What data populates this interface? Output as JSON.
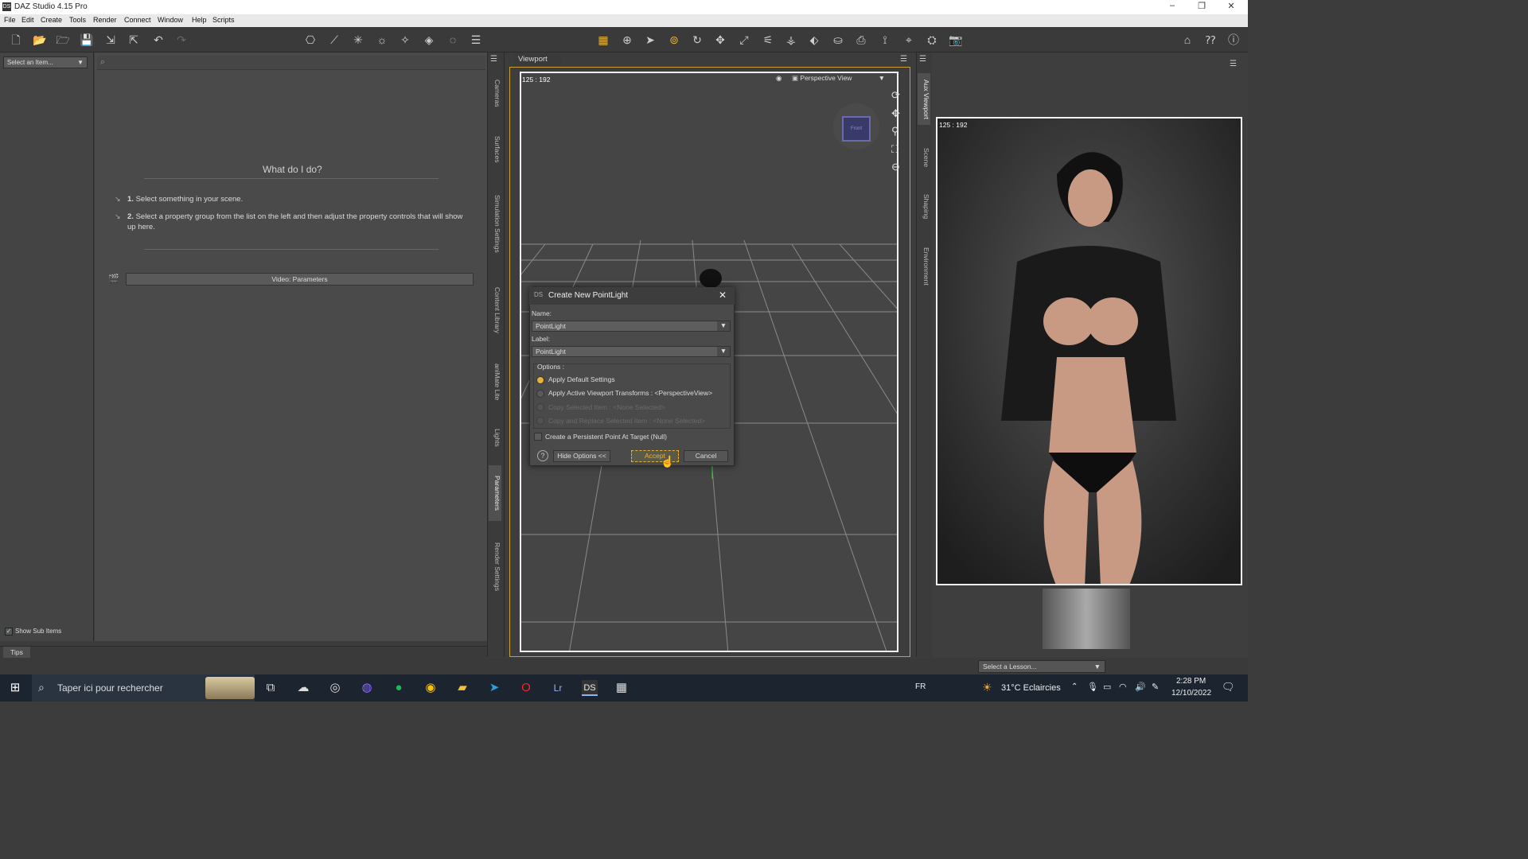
{
  "window": {
    "title": "DAZ Studio 4.15 Pro",
    "logo": "DS"
  },
  "menu": [
    "File",
    "Edit",
    "Create",
    "Tools",
    "Render",
    "Connect",
    "Window",
    "Help",
    "Scripts"
  ],
  "left": {
    "select_item": "Select an Item...",
    "show_sub_items": "Show Sub Items",
    "tips": "Tips"
  },
  "params": {
    "what_do": "What do I do?",
    "step1_num": "1.",
    "step1": "Select something in your scene.",
    "step2_num": "2.",
    "step2": "Select a property group from the list on the left and then adjust the property controls that will show up here.",
    "video": "Video: Parameters"
  },
  "side_tabs": [
    "Cameras",
    "Surfaces",
    "Simulation Settings",
    "Content Library",
    "aniMate Lite",
    "Lights",
    "Parameters",
    "Render Settings"
  ],
  "aux_tabs": [
    "Aux Viewport",
    "Scene",
    "Shaping",
    "Environment"
  ],
  "viewport": {
    "tab": "Viewport",
    "coord": "125 : 192",
    "view": "Perspective View",
    "cube_label": "Front"
  },
  "aux": {
    "coord": "125 : 192",
    "lesson": "Select a Lesson..."
  },
  "dialog": {
    "title": "Create New PointLight",
    "icon": "DS",
    "name_label": "Name:",
    "name_value": "PointLight",
    "label_label": "Label:",
    "label_value": "PointLight",
    "options": "Options :",
    "opt1": "Apply Default Settings",
    "opt2": "Apply Active Viewport Transforms : <PerspectiveView>",
    "opt3": "Copy Selected Item : <None Selected>",
    "opt4": "Copy and Replace Selected Item : <None Selected>",
    "persist": "Create a Persistent Point At Target (Null)",
    "hide": "Hide Options <<",
    "accept": "Accept",
    "cancel": "Cancel"
  },
  "taskbar": {
    "search": "Taper ici pour rechercher",
    "lang": "FR",
    "weather": "31°C  Eclaircies",
    "time": "2:28 PM",
    "date": "12/10/2022"
  },
  "colors": {
    "accent": "#e8b23a",
    "viewport_border": "#c8a032"
  }
}
